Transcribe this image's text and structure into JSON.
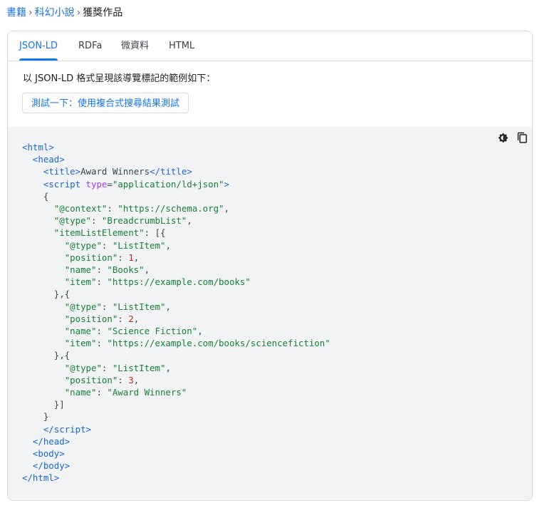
{
  "breadcrumb": {
    "items": [
      {
        "label": "書籍"
      },
      {
        "label": "科幻小說"
      }
    ],
    "separator": "›",
    "current": "獲獎作品"
  },
  "tabs": [
    {
      "label": "JSON-LD",
      "active": true
    },
    {
      "label": "RDFa",
      "active": false
    },
    {
      "label": "微資料",
      "active": false
    },
    {
      "label": "HTML",
      "active": false
    }
  ],
  "intro_text": "以 JSON-LD 格式呈現該導覽標記的範例如下：",
  "test_button_label": "測試一下：使用複合式搜尋結果測試",
  "code_toolbar": {
    "theme_icon": "dark-mode-toggle-icon",
    "copy_icon": "copy-icon"
  },
  "code": {
    "tag_html": "html",
    "tag_head": "head",
    "tag_title": "title",
    "title_text": "Award Winners",
    "tag_script": "script",
    "script_type_attr": "type",
    "script_type_value": "\"application/ld+json\"",
    "tag_body": "body",
    "context_key": "\"@context\"",
    "context_value": "\"https://schema.org\"",
    "type_key": "\"@type\"",
    "type_value": "\"BreadcrumbList\"",
    "list_key": "\"itemListElement\"",
    "item_type_value": "\"ListItem\"",
    "position_key": "\"position\"",
    "name_key": "\"name\"",
    "item_key": "\"item\"",
    "items": [
      {
        "position": "1",
        "name": "\"Books\"",
        "item": "\"https://example.com/books\""
      },
      {
        "position": "2",
        "name": "\"Science Fiction\"",
        "item": "\"https://example.com/books/sciencefiction\""
      },
      {
        "position": "3",
        "name": "\"Award Winners\""
      }
    ]
  },
  "colors": {
    "link_blue": "#1a73e8",
    "code_background": "#f1f3f4",
    "tag_blue": "#1967d2",
    "string_green": "#188038",
    "number_red": "#c5221f",
    "attr_purple": "#a142f4"
  }
}
